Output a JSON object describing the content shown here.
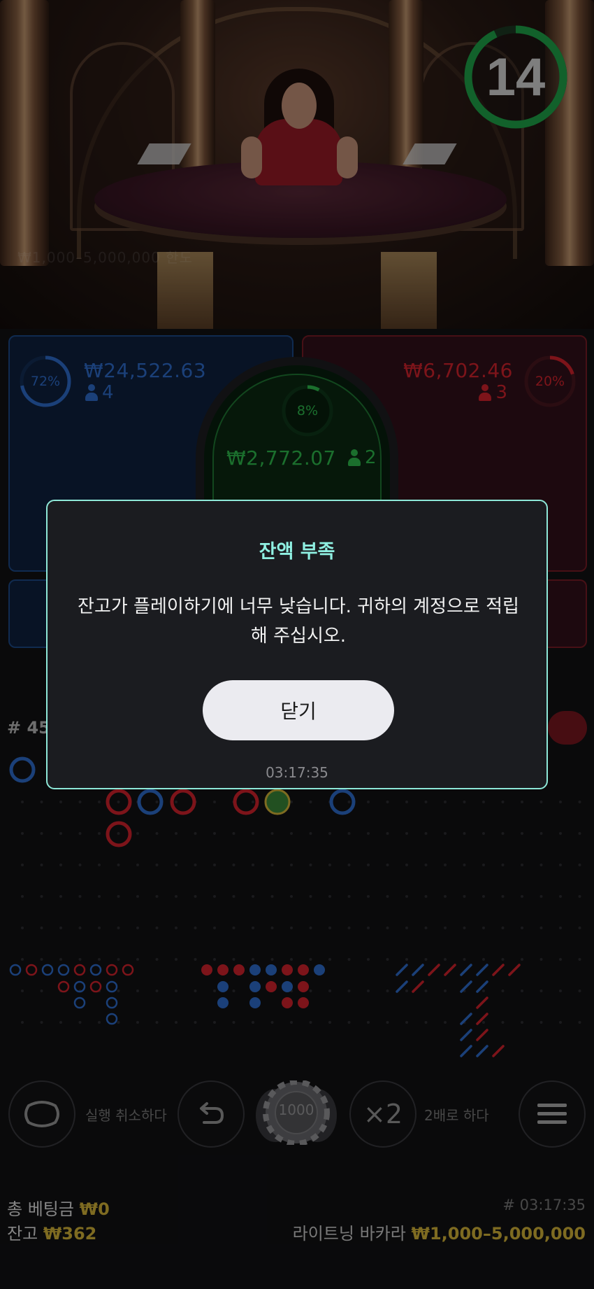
{
  "timer": {
    "value": "14",
    "progress": 0.93,
    "color": "#1fa84a"
  },
  "video": {
    "faint_limit_text": "₩1,000–5,000,000 한도"
  },
  "betting": {
    "player": {
      "percent": "72%",
      "percent_value": 0.72,
      "amount": "₩24,522.63",
      "players": "4",
      "color": "#2f6fd0"
    },
    "tie": {
      "percent": "8%",
      "percent_value": 0.08,
      "amount": "₩2,772.07",
      "players": "2",
      "color": "#2fbf4f"
    },
    "banker": {
      "percent": "20%",
      "percent_value": 0.2,
      "amount": "₩6,702.46",
      "players": "3",
      "color": "#d8242e"
    }
  },
  "roads": {
    "round_number": "# 45"
  },
  "controls": {
    "undo_label": "실행 취소하다",
    "chip_value": "1000",
    "double_icon_text": "×2",
    "double_label": "2배로 하다"
  },
  "footer": {
    "total_bet_label": "총 베팅금",
    "total_bet_value": "₩0",
    "balance_label": "잔고",
    "balance_value": "₩362",
    "round_id": "# 03:17:35",
    "game_name": "라이트닝 바카라",
    "limits": "₩1,000–5,000,000"
  },
  "modal": {
    "title": "잔액 부족",
    "message": "잔고가 플레이하기에 너무 낮습니다. 귀하의 계정으로 적립해 주십시오.",
    "close_label": "닫기",
    "time": "03:17:35"
  },
  "colors": {
    "accent_teal": "#8ee8d8",
    "player_blue": "#2f6fd0",
    "banker_red": "#d8242e",
    "tie_green": "#2fbf4f",
    "gold": "#d9b93a"
  }
}
